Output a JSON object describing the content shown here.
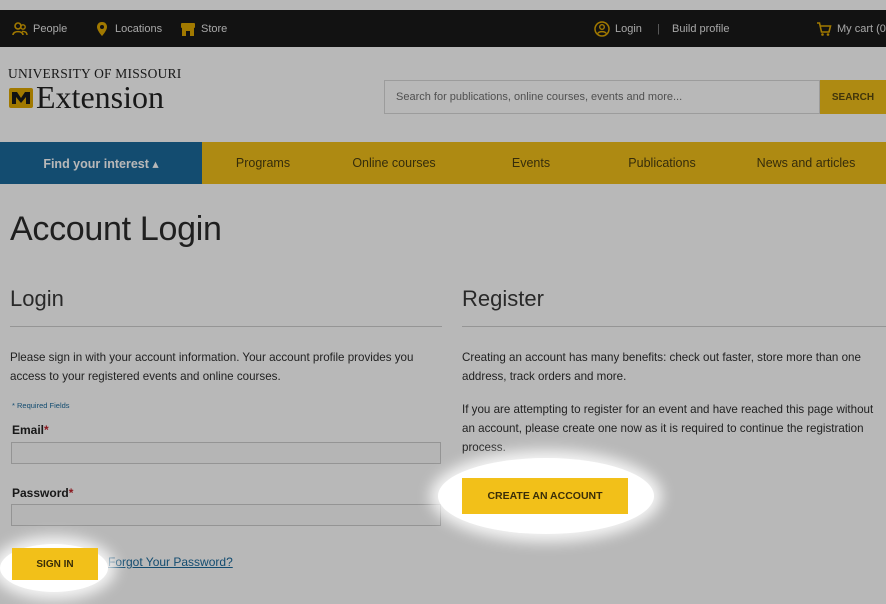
{
  "topbar": {
    "people": "People",
    "locations": "Locations",
    "store": "Store",
    "login": "Login",
    "separator": "|",
    "build_profile": "Build profile",
    "cart": "My cart (0"
  },
  "logo": {
    "university": "UNIVERSITY OF MISSOURI",
    "name": "Extension"
  },
  "search": {
    "placeholder": "Search for publications, online courses, events and more...",
    "button": "SEARCH"
  },
  "nav": {
    "items": [
      {
        "label": "Find your interest ▴"
      },
      {
        "label": "Programs"
      },
      {
        "label": "Online courses"
      },
      {
        "label": "Events"
      },
      {
        "label": "Publications"
      },
      {
        "label": "News and articles"
      }
    ]
  },
  "page": {
    "title": "Account Login"
  },
  "login": {
    "heading": "Login",
    "intro": "Please sign in with your account information. Your account profile provides you access to your registered events and online courses.",
    "required_note": "* Required Fields",
    "email_label": "Email",
    "password_label": "Password",
    "required_mark": "*",
    "sign_in": "SIGN IN",
    "forgot": "Forgot Your Password?"
  },
  "register": {
    "heading": "Register",
    "p1": "Creating an account has many benefits: check out faster, store more than one address, track orders and more.",
    "p2": "If you are attempting to register for an event and have reached this page without an account, please create one now as it is required to continue the registration process.",
    "create_account": "CREATE AN ACCOUNT"
  },
  "colors": {
    "accent_yellow": "#f2c019",
    "nav_active_blue": "#1b6a9c",
    "topbar": "#1a1a1a",
    "required_red": "#c0202a"
  },
  "icons": {
    "people": "people-icon",
    "location": "location-pin-icon",
    "store": "store-icon",
    "user": "user-circle-icon",
    "cart": "cart-icon"
  }
}
